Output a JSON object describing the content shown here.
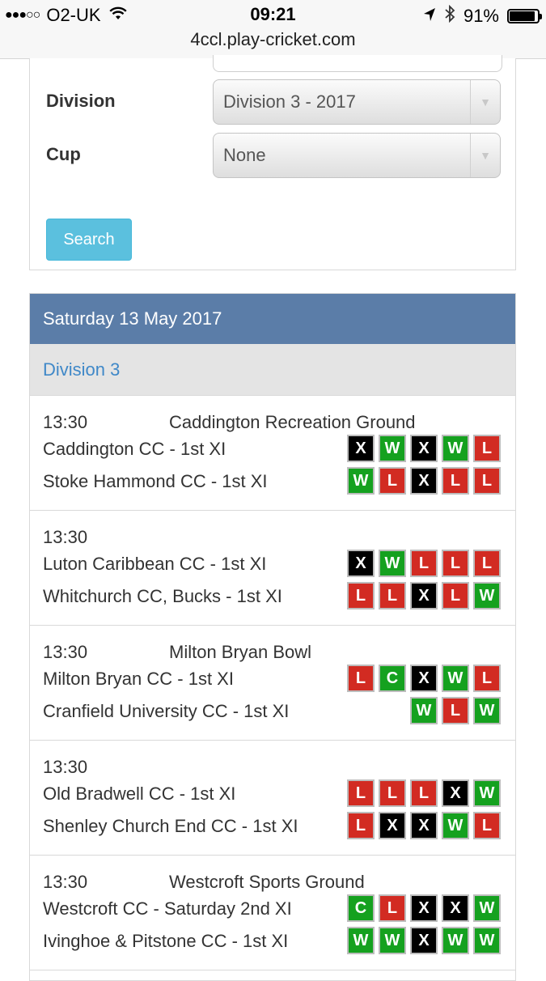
{
  "status_bar": {
    "signal_dots": "●●●○○",
    "carrier": "O2-UK",
    "time": "09:21",
    "battery": "91%",
    "battery_level": 0.91,
    "url": "4ccl.play-cricket.com"
  },
  "filters": {
    "division_label": "Division",
    "division_value": "Division 3 - 2017",
    "cup_label": "Cup",
    "cup_value": "None",
    "search_label": "Search"
  },
  "fixtures": {
    "date": "Saturday 13 May 2017",
    "division": "Division 3",
    "matches": [
      {
        "time": "13:30",
        "ground": "Caddington Recreation Ground",
        "home": {
          "name": "Caddington CC - 1st XI",
          "form": [
            "X",
            "W",
            "X",
            "W",
            "L"
          ]
        },
        "away": {
          "name": "Stoke Hammond CC - 1st XI",
          "form": [
            "W",
            "L",
            "X",
            "L",
            "L"
          ]
        }
      },
      {
        "time": "13:30",
        "ground": "",
        "home": {
          "name": "Luton Caribbean CC - 1st XI",
          "form": [
            "X",
            "W",
            "L",
            "L",
            "L"
          ]
        },
        "away": {
          "name": "Whitchurch CC, Bucks - 1st XI",
          "form": [
            "L",
            "L",
            "X",
            "L",
            "W"
          ]
        }
      },
      {
        "time": "13:30",
        "ground": "Milton Bryan Bowl",
        "home": {
          "name": "Milton Bryan CC - 1st XI",
          "form": [
            "L",
            "C",
            "X",
            "W",
            "L"
          ]
        },
        "away": {
          "name": "Cranfield University CC - 1st XI",
          "form": [
            "W",
            "L",
            "W"
          ]
        }
      },
      {
        "time": "13:30",
        "ground": "",
        "home": {
          "name": "Old Bradwell CC - 1st XI",
          "form": [
            "L",
            "L",
            "L",
            "X",
            "W"
          ]
        },
        "away": {
          "name": "Shenley Church End CC - 1st XI",
          "form": [
            "L",
            "X",
            "X",
            "W",
            "L"
          ]
        }
      },
      {
        "time": "13:30",
        "ground": "Westcroft Sports Ground",
        "home": {
          "name": "Westcroft CC - Saturday 2nd XI",
          "form": [
            "C",
            "L",
            "X",
            "X",
            "W"
          ]
        },
        "away": {
          "name": "Ivinghoe & Pitstone CC - 1st XI",
          "form": [
            "W",
            "W",
            "X",
            "W",
            "W"
          ]
        }
      }
    ]
  },
  "colors": {
    "header_blue": "#5b7da8",
    "division_link": "#3f88c8",
    "win": "#15a11f",
    "loss": "#d22b22",
    "no_result": "#000000",
    "search_button": "#5bc0de"
  }
}
